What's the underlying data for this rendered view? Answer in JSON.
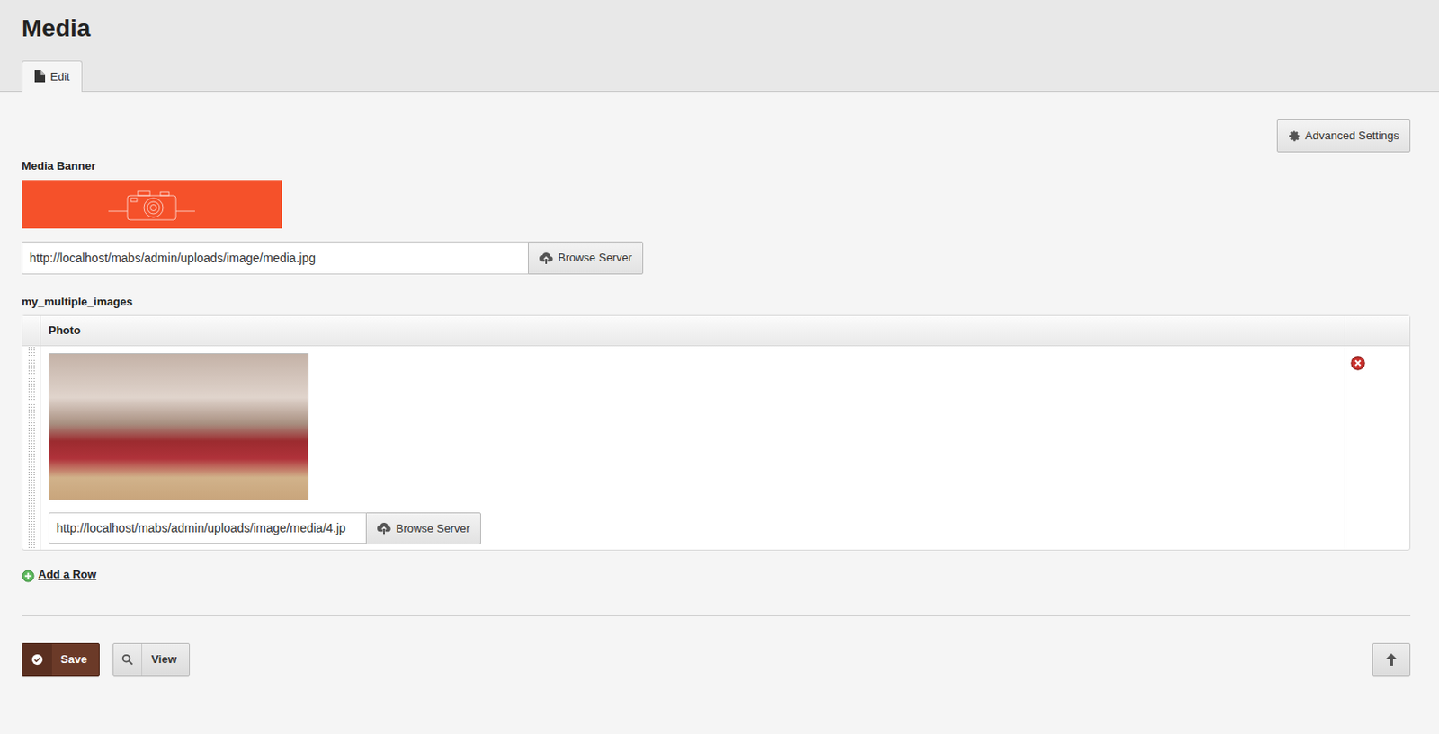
{
  "page": {
    "title": "Media"
  },
  "tabs": [
    {
      "label": "Edit",
      "selected": true
    }
  ],
  "advanced_settings": "Advanced Settings",
  "banner": {
    "label": "Media Banner",
    "url": "http://localhost/mabs/admin/uploads/image/media.jpg",
    "browse": "Browse Server"
  },
  "images": {
    "label": "my_multiple_images",
    "columns": [
      "Photo"
    ],
    "rows": [
      {
        "url": "http://localhost/mabs/admin/uploads/image/media/4.jp",
        "browse": "Browse Server"
      }
    ],
    "add_row": "Add a Row"
  },
  "buttons": [
    {
      "label": "Save"
    },
    {
      "label": "View"
    }
  ]
}
